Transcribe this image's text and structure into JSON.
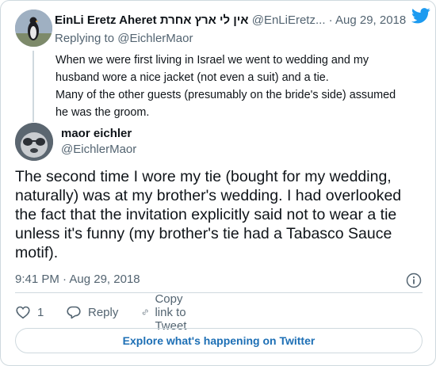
{
  "reply_tweet": {
    "display_name": "EinLi Eretz Aheret אין לי ארץ אחרת",
    "handle": "@EnLiEretz...",
    "separator": "·",
    "date": "Aug 29, 2018",
    "replying_prefix": "Replying to",
    "replying_handle": "@EichlerMaor",
    "text_lines": [
      "When we were first living in Israel we went to wedding and my",
      "husband wore a nice jacket (not even a suit) and a tie.",
      "Many of the other guests (presumably on the bride's side) assumed",
      "he was the groom."
    ]
  },
  "main_tweet": {
    "display_name": "maor eichler",
    "handle": "@EichlerMaor",
    "text_lines": [
      "The second time I wore my tie (bought for my wedding,",
      "naturally) was at my brother's wedding. I had overlooked",
      "the fact that the invitation explicitly said not to wear a tie",
      "unless it's funny (my brother's tie had a Tabasco Sauce",
      "motif)."
    ],
    "time": "9:41 PM",
    "separator": "·",
    "date": "Aug 29, 2018"
  },
  "actions": {
    "like_count": "1",
    "reply_label": "Reply",
    "copy_link_label": "Copy link to Tweet"
  },
  "explore_label": "Explore what's happening on Twitter",
  "icons": [
    "twitter-bird-icon",
    "info-icon",
    "heart-icon",
    "reply-icon",
    "link-icon"
  ],
  "colors": {
    "brand": "#1d9bf0",
    "link": "#1d6fb5",
    "muted": "#536471",
    "border": "#cfd9de"
  }
}
